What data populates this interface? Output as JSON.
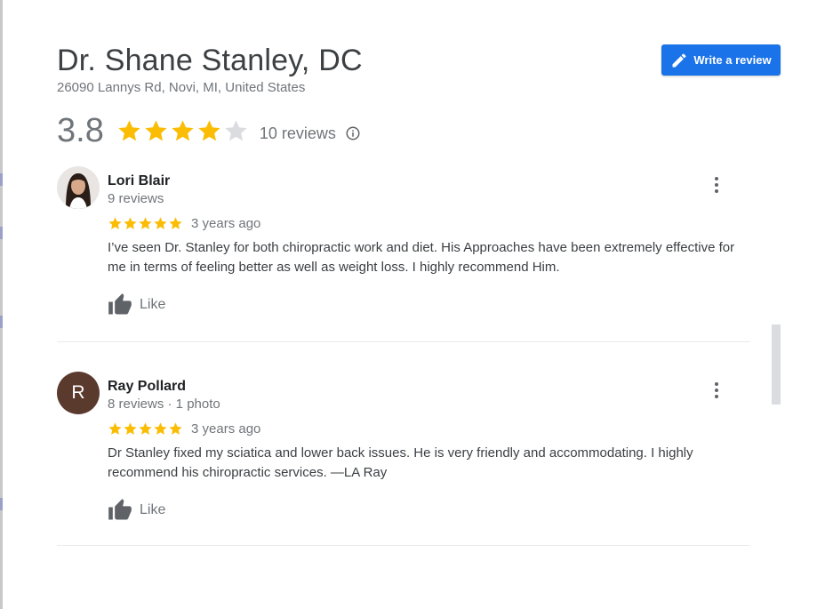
{
  "header": {
    "title": "Dr. Shane Stanley, DC",
    "address": "26090 Lannys Rd, Novi, MI, United States",
    "write_review_label": "Write a review"
  },
  "summary": {
    "rating": "3.8",
    "stars_filled": 4,
    "reviews_count": "10 reviews"
  },
  "reviews": [
    {
      "name": "Lori Blair",
      "meta": "9 reviews",
      "stars": 5,
      "time": "3 years ago",
      "text": "I’ve seen Dr. Stanley for both chiropractic work and diet. His Approaches have been extremely effective for me in terms of feeling better as well as weight loss. I highly recommend Him.",
      "like_label": "Like"
    },
    {
      "name": "Ray Pollard",
      "avatar_letter": "R",
      "meta": "8 reviews · 1 photo",
      "stars": 5,
      "time": "3 years ago",
      "text": "Dr Stanley fixed my sciatica and lower back issues. He is very friendly and accommodating. I highly recommend his chiropractic services. —LA Ray",
      "like_label": "Like"
    }
  ],
  "colors": {
    "star_filled": "#fbbc04",
    "star_empty": "#dadce0",
    "accent": "#1a73e8"
  }
}
